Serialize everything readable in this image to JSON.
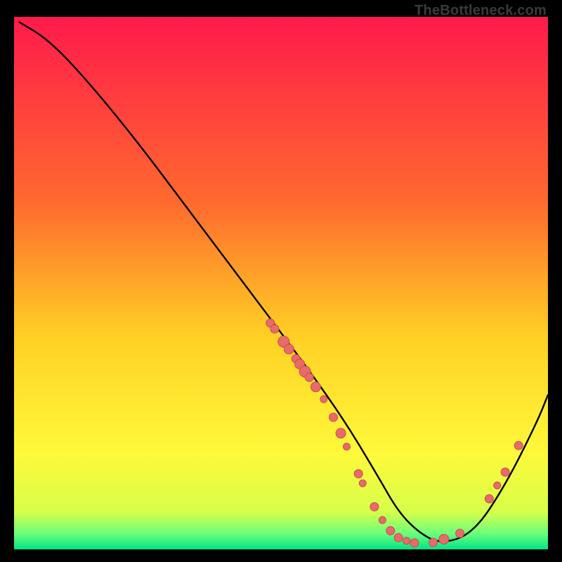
{
  "watermark": "TheBottleneck.com",
  "chart_data": {
    "type": "line",
    "title": "",
    "xlabel": "",
    "ylabel": "",
    "xlim": [
      0,
      100
    ],
    "ylim": [
      0,
      100
    ],
    "gradient_stops": [
      {
        "offset": 0,
        "color": "#ff1a4b"
      },
      {
        "offset": 35,
        "color": "#ff6a2e"
      },
      {
        "offset": 60,
        "color": "#ffd024"
      },
      {
        "offset": 82,
        "color": "#fff93a"
      },
      {
        "offset": 93,
        "color": "#d6ff4a"
      },
      {
        "offset": 97,
        "color": "#6dff7a"
      },
      {
        "offset": 100,
        "color": "#00e587"
      }
    ],
    "series": [
      {
        "name": "bottleneck-curve",
        "x": [
          1,
          6,
          12,
          22,
          34,
          46,
          55,
          62,
          68,
          72,
          76,
          80,
          86,
          92,
          98,
          100
        ],
        "y": [
          99,
          96,
          90,
          78,
          62,
          46,
          34,
          24,
          14,
          7,
          3,
          1,
          3,
          12,
          24,
          29
        ]
      }
    ],
    "markers": {
      "name": "highlight-points",
      "color": "#e86a6a",
      "stroke": "#c94d4d",
      "points": [
        {
          "x": 48.0,
          "y": 42.5,
          "r": 6
        },
        {
          "x": 48.8,
          "y": 41.4,
          "r": 6
        },
        {
          "x": 50.5,
          "y": 39.0,
          "r": 8
        },
        {
          "x": 51.5,
          "y": 37.6,
          "r": 7
        },
        {
          "x": 52.8,
          "y": 35.8,
          "r": 6
        },
        {
          "x": 53.5,
          "y": 34.8,
          "r": 7
        },
        {
          "x": 54.5,
          "y": 33.4,
          "r": 8
        },
        {
          "x": 55.3,
          "y": 32.3,
          "r": 6
        },
        {
          "x": 56.5,
          "y": 30.5,
          "r": 7
        },
        {
          "x": 58.0,
          "y": 28.2,
          "r": 5
        },
        {
          "x": 59.8,
          "y": 24.8,
          "r": 6
        },
        {
          "x": 61.2,
          "y": 21.8,
          "r": 7
        },
        {
          "x": 62.3,
          "y": 19.3,
          "r": 5
        },
        {
          "x": 64.5,
          "y": 14.2,
          "r": 6
        },
        {
          "x": 65.3,
          "y": 12.4,
          "r": 5
        },
        {
          "x": 67.5,
          "y": 8.0,
          "r": 6
        },
        {
          "x": 69.0,
          "y": 5.5,
          "r": 5
        },
        {
          "x": 70.5,
          "y": 3.5,
          "r": 6
        },
        {
          "x": 72.0,
          "y": 2.2,
          "r": 6
        },
        {
          "x": 73.5,
          "y": 1.6,
          "r": 5
        },
        {
          "x": 75.0,
          "y": 1.2,
          "r": 6
        },
        {
          "x": 78.5,
          "y": 1.3,
          "r": 6
        },
        {
          "x": 80.5,
          "y": 1.9,
          "r": 7
        },
        {
          "x": 83.5,
          "y": 3.0,
          "r": 6
        },
        {
          "x": 89.0,
          "y": 9.5,
          "r": 6
        },
        {
          "x": 90.5,
          "y": 12.0,
          "r": 5
        },
        {
          "x": 92.0,
          "y": 14.5,
          "r": 6
        },
        {
          "x": 94.5,
          "y": 19.5,
          "r": 6
        }
      ]
    }
  }
}
